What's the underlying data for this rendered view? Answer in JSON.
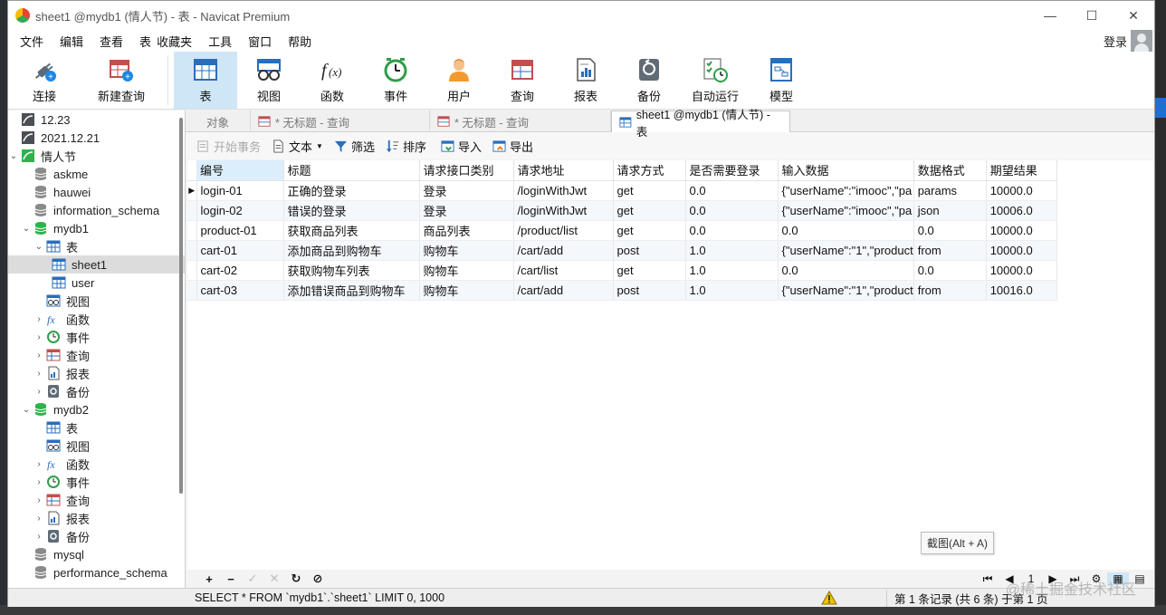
{
  "window": {
    "title": "sheet1 @mydb1 (情人节) - 表 - Navicat Premium"
  },
  "menu": [
    "文件",
    "编辑",
    "查看",
    "表",
    "收藏夹",
    "工具",
    "窗口",
    "帮助"
  ],
  "login_label": "登录",
  "toolbar": [
    {
      "key": "connect",
      "label": "连接"
    },
    {
      "key": "newquery",
      "label": "新建查询"
    },
    {
      "key": "table",
      "label": "表"
    },
    {
      "key": "view",
      "label": "视图"
    },
    {
      "key": "function",
      "label": "函数"
    },
    {
      "key": "event",
      "label": "事件"
    },
    {
      "key": "user",
      "label": "用户"
    },
    {
      "key": "query",
      "label": "查询"
    },
    {
      "key": "report",
      "label": "报表"
    },
    {
      "key": "backup",
      "label": "备份"
    },
    {
      "key": "autorun",
      "label": "自动运行"
    },
    {
      "key": "model",
      "label": "模型"
    }
  ],
  "tree": [
    {
      "label": "12.23"
    },
    {
      "label": "2021.12.21"
    },
    {
      "label": "情人节"
    },
    {
      "label": "askme"
    },
    {
      "label": "hauwei"
    },
    {
      "label": "information_schema"
    },
    {
      "label": "mydb1"
    },
    {
      "label": "表"
    },
    {
      "label": "sheet1"
    },
    {
      "label": "user"
    },
    {
      "label": "视图"
    },
    {
      "label": "函数"
    },
    {
      "label": "事件"
    },
    {
      "label": "查询"
    },
    {
      "label": "报表"
    },
    {
      "label": "备份"
    },
    {
      "label": "mydb2"
    },
    {
      "label": "表"
    },
    {
      "label": "视图"
    },
    {
      "label": "函数"
    },
    {
      "label": "事件"
    },
    {
      "label": "查询"
    },
    {
      "label": "报表"
    },
    {
      "label": "备份"
    },
    {
      "label": "mysql"
    },
    {
      "label": "performance_schema"
    }
  ],
  "tabs": [
    {
      "label": "对象"
    },
    {
      "label": "* 无标题 - 查询"
    },
    {
      "label": "* 无标题 - 查询"
    },
    {
      "label": "sheet1 @mydb1 (情人节) - 表"
    }
  ],
  "subtoolbar": {
    "begin_tx": "开始事务",
    "text": "文本",
    "filter": "筛选",
    "sort": "排序",
    "import": "导入",
    "export": "导出"
  },
  "table": {
    "columns": [
      "编号",
      "标题",
      "请求接口类别",
      "请求地址",
      "请求方式",
      "是否需要登录",
      "输入数据",
      "数据格式",
      "期望结果"
    ],
    "rows": [
      [
        "login-01",
        "正确的登录",
        "登录",
        "/loginWithJwt",
        "get",
        "0.0",
        "{\"userName\":\"imooc\",\"pa",
        "params",
        "10000.0"
      ],
      [
        "login-02",
        "错误的登录",
        "登录",
        "/loginWithJwt",
        "get",
        "0.0",
        "{\"userName\":\"imooc\",\"pa",
        "json",
        "10006.0"
      ],
      [
        "product-01",
        "获取商品列表",
        "商品列表",
        "/product/list",
        "get",
        "0.0",
        "0.0",
        "0.0",
        "10000.0"
      ],
      [
        "cart-01",
        "添加商品到购物车",
        "购物车",
        "/cart/add",
        "post",
        "1.0",
        "{\"userName\":\"1\",\"product",
        "from",
        "10000.0"
      ],
      [
        "cart-02",
        "获取购物车列表",
        "购物车",
        "/cart/list",
        "get",
        "1.0",
        "0.0",
        "0.0",
        "10000.0"
      ],
      [
        "cart-03",
        "添加错误商品到购物车",
        "购物车",
        "/cart/add",
        "post",
        "1.0",
        "{\"userName\":\"1\",\"product",
        "from",
        "10016.0"
      ]
    ]
  },
  "tooltip": "截图(Alt + A)",
  "pager": {
    "page": "1"
  },
  "status": {
    "sql": "SELECT * FROM `mydb1`.`sheet1` LIMIT 0, 1000",
    "records": "第 1 条记录 (共 6 条) 于第 1 页"
  },
  "watermark": "@稀土掘金技术社区",
  "colors": {
    "accent": "#cfe6f7",
    "db_green": "#2fb24c",
    "selected": "#dcdcdc"
  }
}
